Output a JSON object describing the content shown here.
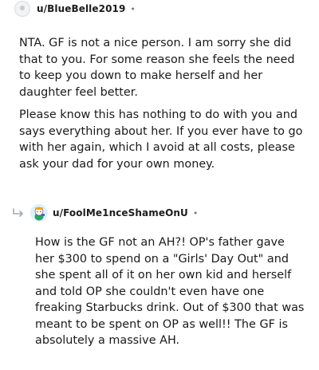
{
  "comment1": {
    "username": "u/BlueBelle2019",
    "separator": "•",
    "paragraphs": [
      "NTA. GF is not a nice person. I am sorry she did that to you. For some reason she feels the need to keep you down to make herself and her daughter feel better.",
      "Please know this has nothing to do with you and says everything about her. If you ever have to go with her again, which I avoid at all costs, please ask your dad for your own money."
    ]
  },
  "comment2": {
    "username": "u/FoolMe1nceShameOnU",
    "separator": "•",
    "paragraphs": [
      "How is the GF not an AH?! OP's father gave her $300 to spend on a \"Girls' Day Out\" and she spent all of it on her own kid and herself and told OP she couldn't even have one freaking Starbucks drink. Out of $300 that was meant to be spent on OP as well!! The GF is absolutely a massive AH."
    ]
  },
  "icons": {
    "reply": "reply-arrow-icon",
    "avatar1": "avatar-placeholder-icon",
    "avatar2": "snoo-avatar-icon"
  }
}
